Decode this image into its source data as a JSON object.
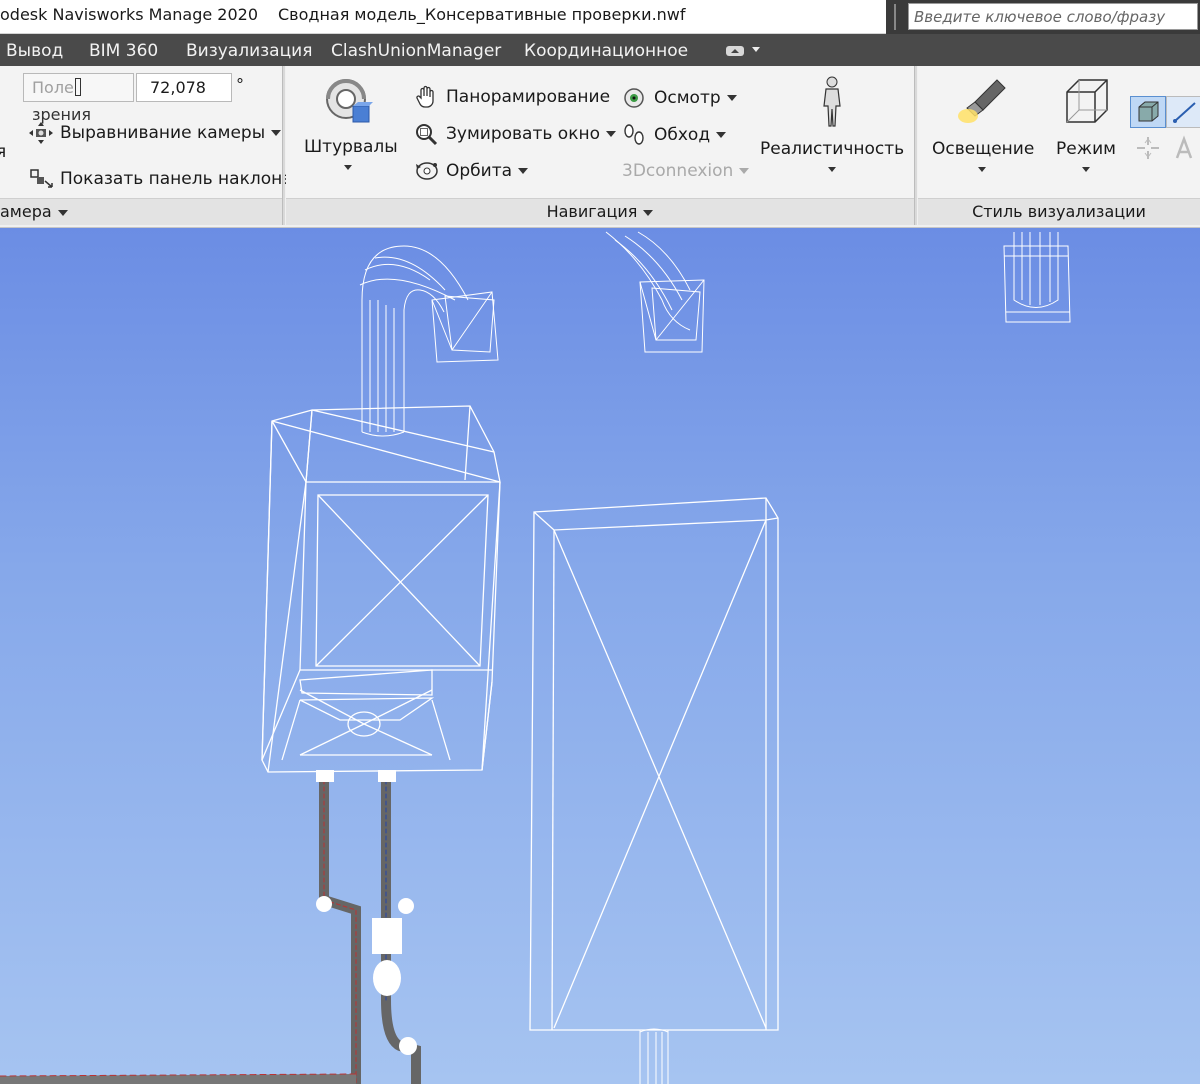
{
  "titlebar": {
    "app_title": "odesk Navisworks Manage 2020",
    "file_name": "Сводная модель_Консервативные проверки.nwf"
  },
  "search": {
    "placeholder": "Введите ключевое слово/фразу"
  },
  "tabs": [
    {
      "label": "Вывод"
    },
    {
      "label": "BIM 360"
    },
    {
      "label": "Визуализация"
    },
    {
      "label": "ClashUnionManager"
    },
    {
      "label": "Координационное"
    }
  ],
  "camera_panel": {
    "fov_label_prefix": "Поле",
    "fov_label_suffix": "зрения",
    "fov_value": "72,078",
    "fov_unit": "°",
    "partial_left_text": "я",
    "align_camera": "Выравнивание камеры",
    "show_tilt_bar": "Показать панель наклона",
    "footer": "амера"
  },
  "navigation_panel": {
    "steering_wheels": "Штурвалы",
    "pan": "Панорамирование",
    "zoom_window": "Зумировать окно",
    "orbit": "Орбита",
    "look_around": "Осмотр",
    "walk": "Обход",
    "connexion": "3Dconnexion",
    "realism": "Реалистичность",
    "footer": "Навигация"
  },
  "render_style_panel": {
    "lighting": "Освещение",
    "mode": "Режим",
    "footer": "Стиль визуализации"
  },
  "icons": {
    "pan": "hand-icon",
    "zoom_window": "magnifier-icon",
    "orbit": "orbit-icon",
    "look_around": "eye-icon",
    "walk": "footprints-icon",
    "align_camera": "align-camera-icon",
    "tilt_bar": "tilt-bar-icon",
    "steering_wheels": "steering-wheel-icon",
    "realism": "person-icon",
    "lighting": "flashlight-icon",
    "mode": "cube-wireframe-icon"
  },
  "colors": {
    "tab_bar": "#4a4a4a",
    "viewport_top": "#6b8de4",
    "viewport_bottom": "#a6c4f1",
    "wireframe": "#ffffff",
    "active_view_button": "#bfd8f5"
  }
}
